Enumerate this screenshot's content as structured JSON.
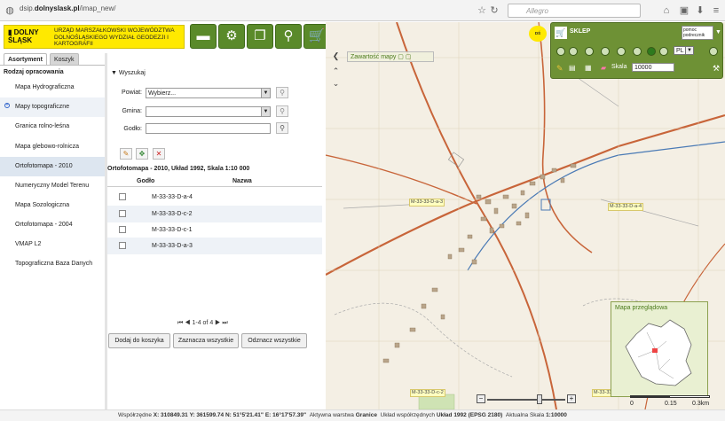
{
  "browser": {
    "url_prefix": "dsip.",
    "url_domain": "dolnyslask.pl",
    "url_path": "/imap_new/",
    "search_placeholder": "Allegro"
  },
  "header": {
    "logo_name": "DOLNY ŚLĄSK",
    "logo_text": "URZĄD MARSZAŁKOWSKI WOJEWÓDZTWA DOLNOŚLĄSKIEGO WYDZIAŁ GEODEZJI I KARTOGRAFII",
    "tool_icons": [
      "folder-icon",
      "gear-icon",
      "windows-icon",
      "search-icon",
      "cart-icon"
    ]
  },
  "tabs": [
    "Asortyment",
    "Koszyk"
  ],
  "left": {
    "heading": "Rodzaj opracowania",
    "items": [
      "Mapa Hydrograficzna",
      "Mapy topograficzne",
      "Granica rolno-leśna",
      "Mapa glebowo-rolnicza",
      "Ortofotomapa - 2010",
      "Numeryczny Model Terenu",
      "Mapa Sozologiczna",
      "Ortofotomapa - 2004",
      "VMAP L2",
      "Topograficzna Baza Danych"
    ]
  },
  "search": {
    "title": "Wyszukaj",
    "powiat_label": "Powiat:",
    "powiat_value": "Wybierz...",
    "gmina_label": "Gmina:",
    "gmina_value": "",
    "godlo_label": "Godło:",
    "godlo_value": ""
  },
  "results": {
    "title": "Ortofotomapa - 2010, Układ 1992, Skala 1:10 000",
    "col_godlo": "Godło",
    "col_nazwa": "Nazwa",
    "rows": [
      "M-33-33-D-a-4",
      "M-33-33-D-c-2",
      "M-33-33-D-c-1",
      "M-33-33-D-a-3"
    ],
    "pager": "1-4 of 4",
    "btn_add": "Dodaj do koszyka",
    "btn_select_all": "Zaznacza wszystkie",
    "btn_deselect_all": "Odznacz wszystkie"
  },
  "map": {
    "contents_label": "Zawartość mapy",
    "shop_label": "SKLEP",
    "help_label": "POMOC",
    "help_sub": "pomoc podrecznik",
    "lang": "PL",
    "scale_label": "Skala",
    "scale_value": "10000",
    "overview_label": "Mapa przeglądowa",
    "scalebar_0": "0",
    "scalebar_1": "0.15",
    "scalebar_2": "0.3km",
    "sheet_labels": [
      "M-33-33-D-a-3",
      "M-33-33-D-a-4",
      "M-33-33-D-c-2",
      "M-33-33-D-c-1"
    ],
    "place_label": "Granice"
  },
  "status": {
    "coords_label": "Współrzędne",
    "x": "X: 310849.31",
    "y": "Y: 361599.74",
    "n": "N: 51°5'21.41\"",
    "e": "E: 16°17'57.39\"",
    "layer_label": "Aktywna warstwa",
    "layer": "Granice",
    "cs_label": "Układ współrzędnych",
    "cs": "Układ 1992 (EPSG 2180)",
    "scale_label": "Aktualna Skala",
    "scale": "1:10000"
  }
}
